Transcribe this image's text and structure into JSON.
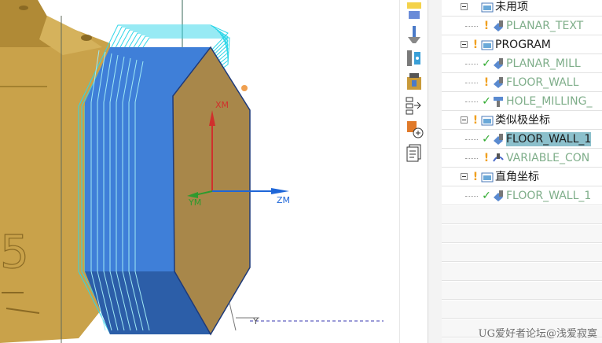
{
  "viewport": {
    "axes": {
      "x": "XM",
      "y": "YM",
      "z": "ZM",
      "wcs_y": "Y"
    },
    "part_engraving": "5",
    "colors": {
      "part": "#c9a24a",
      "wall": "#3f7fd8",
      "face": "#a8874a",
      "toolpath": "#2fd6e8",
      "x_axis": "#d0302c",
      "y_axis": "#2e9a2e",
      "z_axis": "#1e66d8"
    }
  },
  "toolbar": {
    "icons": [
      "operation-navigator-icon",
      "tool-icon",
      "machine-tool-icon",
      "machining-center-icon",
      "sequence-icon",
      "drill-add-icon",
      "report-icon"
    ]
  },
  "tree": {
    "rows": [
      {
        "label": "未用项",
        "status": "",
        "icon": "folder-icon",
        "level": 0,
        "expander": true,
        "style": "norm"
      },
      {
        "label": "PLANAR_TEXT",
        "status": "warn",
        "icon": "operation-icon",
        "level": 1,
        "style": "dim"
      },
      {
        "label": "PROGRAM",
        "status": "warn",
        "icon": "folder-icon",
        "level": 0,
        "expander": true,
        "style": "norm"
      },
      {
        "label": "PLANAR_MILL",
        "status": "ok",
        "icon": "operation-icon",
        "level": 1,
        "style": "dim"
      },
      {
        "label": "FLOOR_WALL",
        "status": "warn",
        "icon": "operation-icon",
        "level": 1,
        "style": "dim"
      },
      {
        "label": "HOLE_MILLING_",
        "status": "ok",
        "icon": "hole-milling-icon",
        "level": 1,
        "style": "dim"
      },
      {
        "label": "类似极坐标",
        "status": "warn",
        "icon": "folder-icon",
        "level": 0,
        "expander": true,
        "style": "norm"
      },
      {
        "label": "FLOOR_WALL_1",
        "status": "ok",
        "icon": "operation-icon",
        "level": 1,
        "style": "norm",
        "selected": true
      },
      {
        "label": "VARIABLE_CON",
        "status": "warn",
        "icon": "variable-contour-icon",
        "level": 1,
        "style": "dim"
      },
      {
        "label": "直角坐标",
        "status": "warn",
        "icon": "folder-icon",
        "level": 0,
        "expander": true,
        "style": "norm"
      },
      {
        "label": "FLOOR_WALL_1",
        "status": "ok",
        "icon": "operation-icon",
        "level": 1,
        "style": "dim"
      }
    ],
    "status_symbols": {
      "warn": "!",
      "ok": "✓"
    }
  },
  "watermark": "UG爱好者论坛@浅爱寂寞"
}
